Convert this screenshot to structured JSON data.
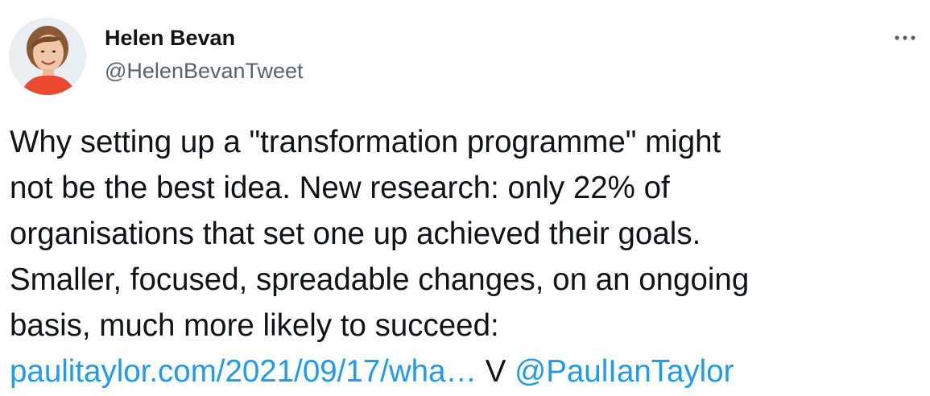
{
  "author": {
    "name": "Helen Bevan",
    "handle": "@HelenBevanTweet"
  },
  "more_menu": {
    "icon": "more-horizontal-icon"
  },
  "tweet": {
    "lines": [
      "Why setting up a \"transformation programme\" might",
      "not be the best idea. New research: only 22% of",
      "organisations that set one up achieved their goals.",
      "Smaller, focused, spreadable changes, on an ongoing",
      "basis, much more likely to succeed:"
    ],
    "link_text": "paulitaylor.com/2021/09/17/wha…",
    "via_text": "V",
    "mention": "@PaulIanTaylor"
  },
  "colors": {
    "text": "#0f1419",
    "secondary": "#536471",
    "link": "#1d9bf0"
  }
}
